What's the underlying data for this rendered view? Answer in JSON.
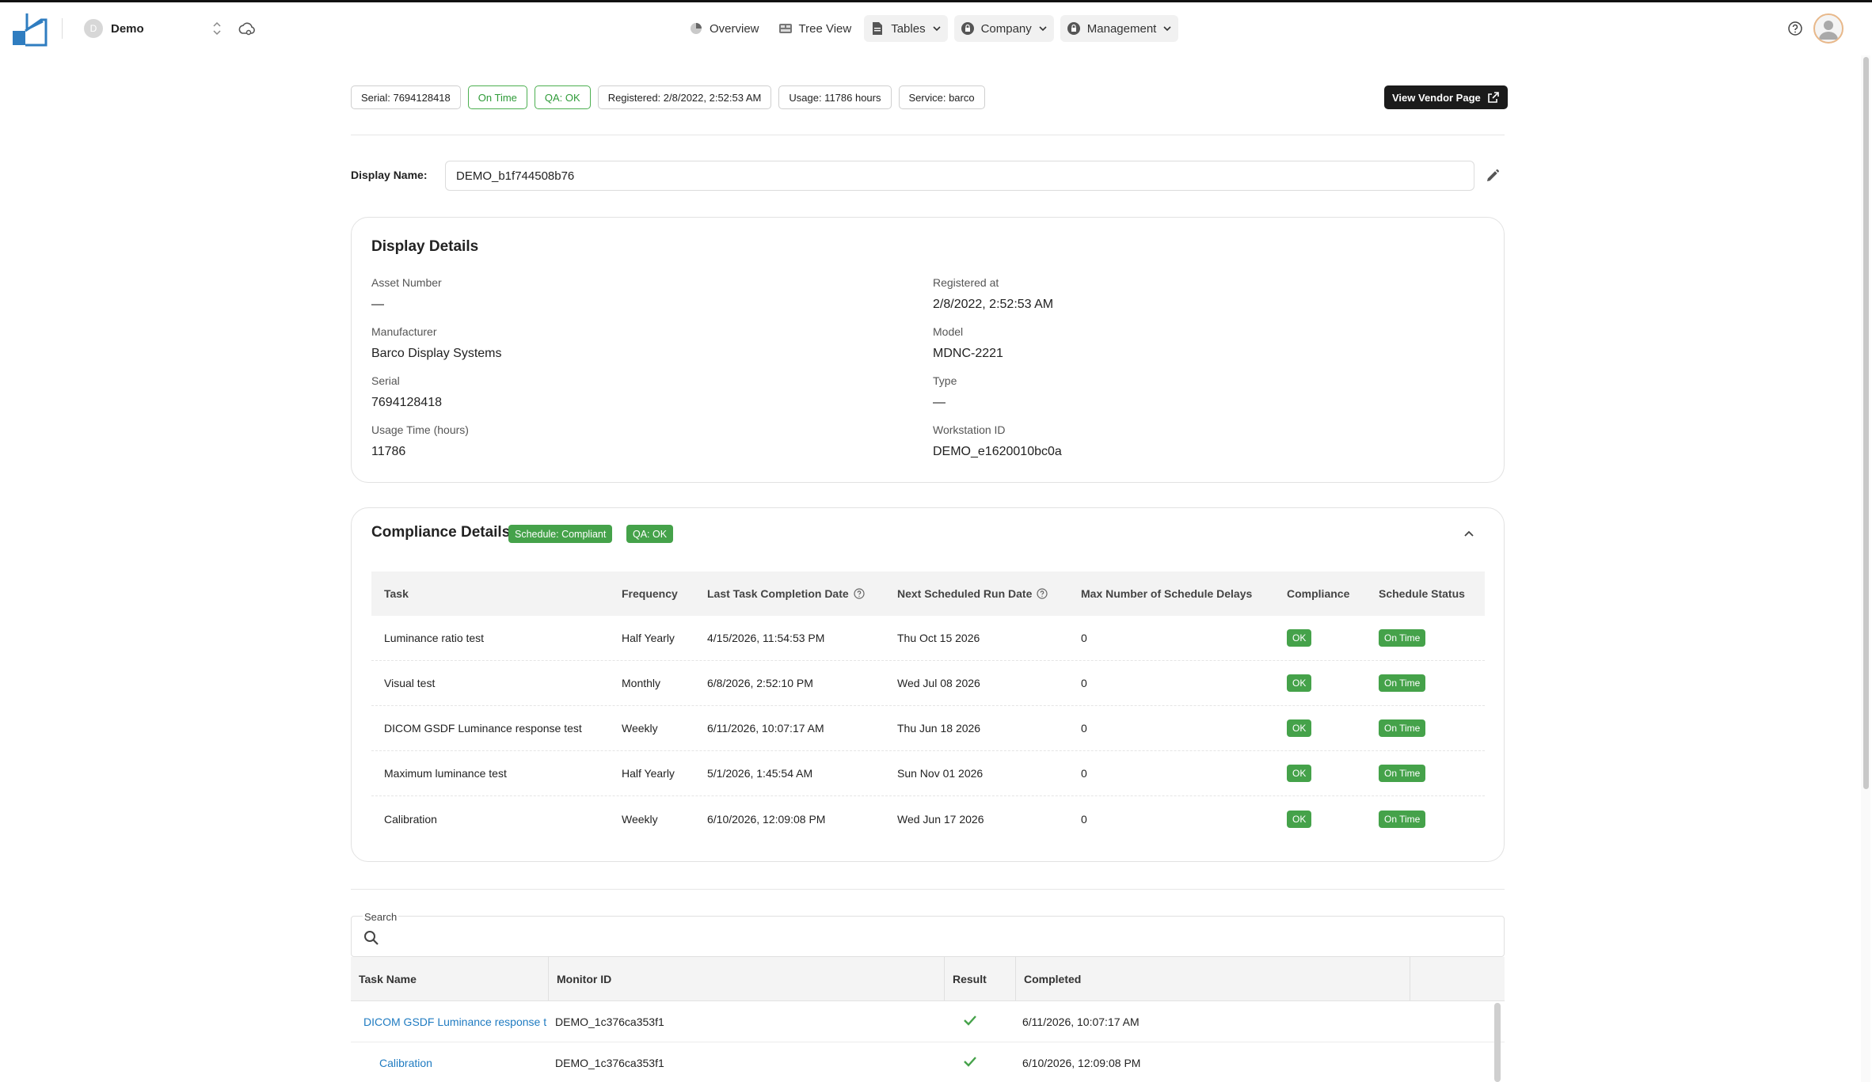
{
  "header": {
    "org_initial": "D",
    "org_name": "Demo",
    "nav": [
      {
        "label": "Overview",
        "icon": "overview-icon"
      },
      {
        "label": "Tree View",
        "icon": "tree-view-icon"
      },
      {
        "label": "Tables",
        "icon": "document-icon",
        "dropdown": true
      },
      {
        "label": "Company",
        "icon": "lock-icon",
        "dropdown": true
      },
      {
        "label": "Management",
        "icon": "lock-icon",
        "dropdown": true
      }
    ]
  },
  "chips": {
    "serial": "Serial: 7694128418",
    "on_time": "On Time",
    "qa": "QA: OK",
    "registered": "Registered: 2/8/2022, 2:52:53 AM",
    "usage": "Usage: 11786 hours",
    "service": "Service: barco"
  },
  "vendor_button": "View Vendor Page",
  "display_name": {
    "label": "Display Name:",
    "value": "DEMO_b1f744508b76"
  },
  "details": {
    "title": "Display Details",
    "asset_number_label": "Asset Number",
    "asset_number": "—",
    "registered_label": "Registered at",
    "registered": "2/8/2022, 2:52:53 AM",
    "manufacturer_label": "Manufacturer",
    "manufacturer": "Barco Display Systems",
    "model_label": "Model",
    "model": "MDNC-2221",
    "serial_label": "Serial",
    "serial": "7694128418",
    "type_label": "Type",
    "type": "—",
    "usage_label": "Usage Time (hours)",
    "usage": "11786",
    "workstation_label": "Workstation ID",
    "workstation": "DEMO_e1620010bc0a"
  },
  "compliance": {
    "title": "Compliance Details",
    "badge_schedule": "Schedule: Compliant",
    "badge_qa": "QA: OK",
    "columns": {
      "task": "Task",
      "frequency": "Frequency",
      "last": "Last Task Completion Date",
      "next": "Next Scheduled Run Date",
      "max": "Max Number of Schedule Delays",
      "compliance": "Compliance",
      "status": "Schedule Status"
    },
    "rows": [
      {
        "task": "Luminance ratio test",
        "frequency": "Half Yearly",
        "last": "4/15/2026, 11:54:53 PM",
        "next": "Thu Oct 15 2026",
        "max": "0",
        "compliance": "OK",
        "status": "On Time"
      },
      {
        "task": "Visual test",
        "frequency": "Monthly",
        "last": "6/8/2026, 2:52:10 PM",
        "next": "Wed Jul 08 2026",
        "max": "0",
        "compliance": "OK",
        "status": "On Time"
      },
      {
        "task": "DICOM GSDF Luminance response test",
        "frequency": "Weekly",
        "last": "6/11/2026, 10:07:17 AM",
        "next": "Thu Jun 18 2026",
        "max": "0",
        "compliance": "OK",
        "status": "On Time"
      },
      {
        "task": "Maximum luminance test",
        "frequency": "Half Yearly",
        "last": "5/1/2026, 1:45:54 AM",
        "next": "Sun Nov 01 2026",
        "max": "0",
        "compliance": "OK",
        "status": "On Time"
      },
      {
        "task": "Calibration",
        "frequency": "Weekly",
        "last": "6/10/2026, 12:09:08 PM",
        "next": "Wed Jun 17 2026",
        "max": "0",
        "compliance": "OK",
        "status": "On Time"
      }
    ]
  },
  "search": {
    "label": "Search",
    "placeholder": ""
  },
  "results": {
    "columns": {
      "task_name": "Task Name",
      "monitor_id": "Monitor ID",
      "result": "Result",
      "completed": "Completed"
    },
    "rows": [
      {
        "task_name": "DICOM GSDF Luminance response t",
        "monitor_id": "DEMO_1c376ca353f1",
        "result": "check-icon",
        "completed": "6/11/2026, 10:07:17 AM"
      },
      {
        "task_name": "Calibration",
        "monitor_id": "DEMO_1c376ca353f1",
        "result": "check-icon",
        "completed": "6/10/2026, 12:09:08 PM"
      }
    ]
  },
  "colors": {
    "brand_blue": "#2f7dc0",
    "success_green": "#45a24a",
    "link_blue": "#1f7bc1"
  }
}
